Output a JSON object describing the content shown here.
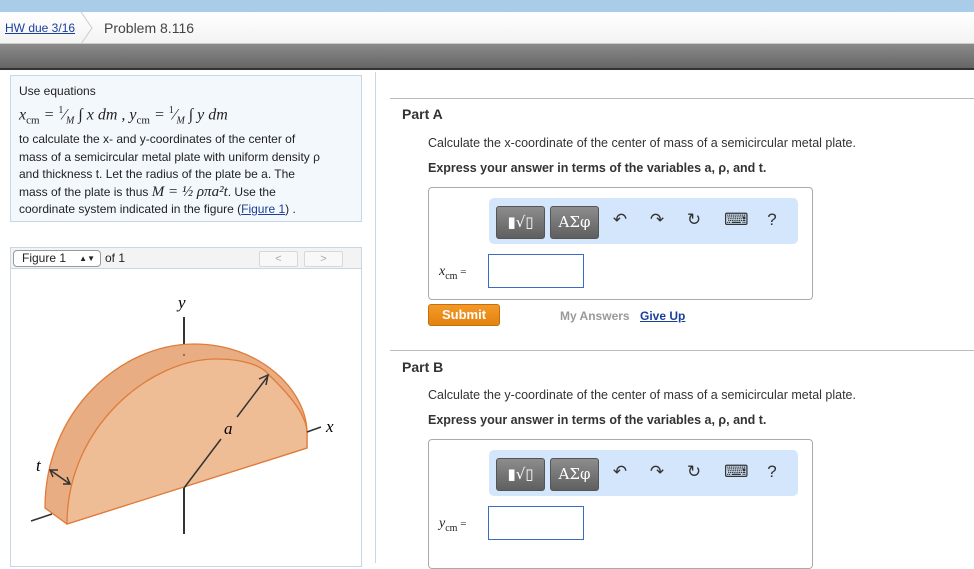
{
  "breadcrumb": {
    "hw": "HW due 3/16",
    "problem": "Problem 8.116"
  },
  "problem": {
    "intro": "Use equations",
    "equation": "x_cm = (1/M) ∫ x dm ,  y_cm = (1/M) ∫ y dm",
    "eq_x": "x",
    "eq_y": "y",
    "eq_sub": "cm",
    "eq_frac": "1",
    "eq_den": "M",
    "eq_dm": "dm",
    "line1": "to calculate the x- and y-coordinates of the center of",
    "line2": "mass of a semicircular metal plate with uniform density ρ",
    "line3": "and thickness t. Let the radius of the plate be a. The",
    "line4a": "mass of the plate is thus ",
    "mass_eq": "M = ½ ρπa²t",
    "line4b": ". Use the",
    "line5a": "coordinate system indicated in the figure (",
    "figure_link": "Figure 1",
    "line5b": ") ."
  },
  "figure": {
    "select": "Figure 1",
    "of": "of 1",
    "prev": "<",
    "next": ">",
    "labels": {
      "y": "y",
      "x": "x",
      "a": "a",
      "t": "t"
    },
    "colors": {
      "front": "#eebd96",
      "side": "#e8ad82",
      "edge": "#e07b39"
    }
  },
  "parts": [
    {
      "title": "Part A",
      "question": "Calculate the x-coordinate of the center of mass of a semicircular metal plate.",
      "express": "Express your answer in terms of the variables a, ρ, and t.",
      "var": "x",
      "sub": "cm",
      "eq": " ="
    },
    {
      "title": "Part B",
      "question": "Calculate the y-coordinate of the center of mass of a semicircular metal plate.",
      "express": "Express your answer in terms of the variables a, ρ, and t.",
      "var": "y",
      "sub": "cm",
      "eq": " ="
    }
  ],
  "toolbar": {
    "templates": "▮√▯",
    "symbols": "ΑΣφ",
    "undo": "↶",
    "redo": "↷",
    "reset": "↻",
    "keyboard": "⌨",
    "help": "?"
  },
  "actions": {
    "submit": "Submit",
    "my_answers": "My Answers",
    "give_up": "Give Up"
  }
}
